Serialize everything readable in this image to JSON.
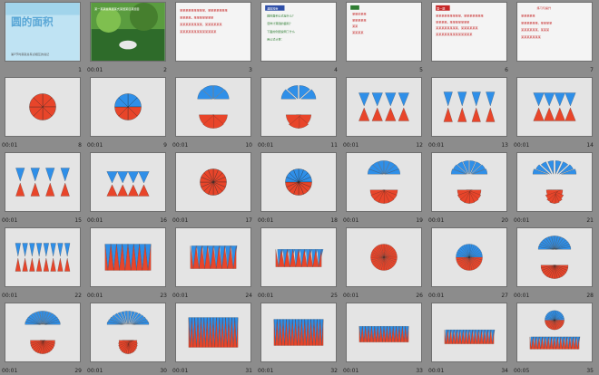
{
  "title_slide": {
    "heading": "圆的面积",
    "footer": "第3节时案就总有点相互的说记"
  },
  "slide_text": {
    "s2_caption": "某一某某些某题某式某题某目某题目",
    "s3_lines": [
      "某某某某某某某某某，某某某某某某某",
      "某某某某。某某某某某某某",
      "某某某某某某某某，某某某某某某",
      "某某某某某某某某某某某某某"
    ],
    "s4_header": "温故知新",
    "s4_lines": [
      "圆的面积公式是什么？",
      "怎样计算圆的面积？",
      "下面的例题说明了什么",
      "用公式计算："
    ],
    "s5_lines": [
      "某某的某某",
      "某某某某某",
      "某某",
      "某某某某"
    ],
    "s6_header": "第一题",
    "s7_header": "练习与提升",
    "s7_lines": [
      "某某某某某",
      "某某某某某某，某某某某",
      "某某某某某某，某某某",
      "某某某某某某某"
    ]
  },
  "slides": [
    {
      "num": "1",
      "time": "",
      "kind": "title",
      "selected": false
    },
    {
      "num": "2",
      "time": "00:01",
      "kind": "photo",
      "selected": false
    },
    {
      "num": "3",
      "time": "",
      "kind": "text3",
      "selected": false
    },
    {
      "num": "4",
      "time": "",
      "kind": "text4",
      "selected": false
    },
    {
      "num": "5",
      "time": "",
      "kind": "text5",
      "selected": false
    },
    {
      "num": "6",
      "time": "",
      "kind": "text6",
      "selected": false
    },
    {
      "num": "7",
      "time": "",
      "kind": "text7",
      "selected": false
    },
    {
      "num": "8",
      "time": "00:01",
      "kind": "circle_red",
      "selected": false
    },
    {
      "num": "9",
      "time": "00:01",
      "kind": "circle_split",
      "selected": false
    },
    {
      "num": "10",
      "time": "00:01",
      "kind": "halves_eye",
      "selected": false
    },
    {
      "num": "11",
      "time": "00:01",
      "kind": "halves_eye2",
      "selected": false
    },
    {
      "num": "12",
      "time": "00:01",
      "kind": "teeth4",
      "selected": false
    },
    {
      "num": "13",
      "time": "00:01",
      "kind": "teeth_gap",
      "selected": false
    },
    {
      "num": "14",
      "time": "00:01",
      "kind": "teeth_joined",
      "selected": false
    },
    {
      "num": "15",
      "time": "00:01",
      "kind": "teeth_gap_b",
      "selected": false
    },
    {
      "num": "16",
      "time": "00:01",
      "kind": "teeth_joined_b",
      "selected": false
    },
    {
      "num": "17",
      "time": "00:01",
      "kind": "circle_fine",
      "selected": false
    },
    {
      "num": "18",
      "time": "00:01",
      "kind": "circle_fine_split",
      "selected": false
    },
    {
      "num": "19",
      "time": "00:01",
      "kind": "halves_eye_fine",
      "selected": false
    },
    {
      "num": "20",
      "time": "00:01",
      "kind": "halves_eye_fine2",
      "selected": false
    },
    {
      "num": "21",
      "time": "00:01",
      "kind": "teeth_fine_open",
      "selected": false
    },
    {
      "num": "22",
      "time": "00:01",
      "kind": "zigzag_gap",
      "selected": false
    },
    {
      "num": "23",
      "time": "00:01",
      "kind": "zigzag_rect",
      "selected": false
    },
    {
      "num": "24",
      "time": "00:01",
      "kind": "zigzag_para",
      "selected": false
    },
    {
      "num": "25",
      "time": "00:01",
      "kind": "zigzag_para2",
      "selected": false
    },
    {
      "num": "26",
      "time": "00:01",
      "kind": "circle_vfine",
      "selected": false
    },
    {
      "num": "27",
      "time": "00:01",
      "kind": "circle_vfine_split",
      "selected": false
    },
    {
      "num": "28",
      "time": "00:01",
      "kind": "halves_vfine",
      "selected": false
    },
    {
      "num": "29",
      "time": "00:01",
      "kind": "halves_vfine_eye",
      "selected": false
    },
    {
      "num": "30",
      "time": "00:01",
      "kind": "halves_vfine_eye2",
      "selected": false
    },
    {
      "num": "31",
      "time": "00:01",
      "kind": "comb_rect",
      "selected": false
    },
    {
      "num": "32",
      "time": "00:01",
      "kind": "comb_rect2",
      "selected": false
    },
    {
      "num": "33",
      "time": "00:01",
      "kind": "comb_low",
      "selected": false
    },
    {
      "num": "34",
      "time": "00:01",
      "kind": "comb_para",
      "selected": false
    },
    {
      "num": "35",
      "time": "00:05",
      "kind": "circle_and_para",
      "selected": false
    }
  ],
  "colors": {
    "red": "#e8452a",
    "blue": "#2f8fe8",
    "line": "#222222",
    "green": "#2e7d32"
  }
}
